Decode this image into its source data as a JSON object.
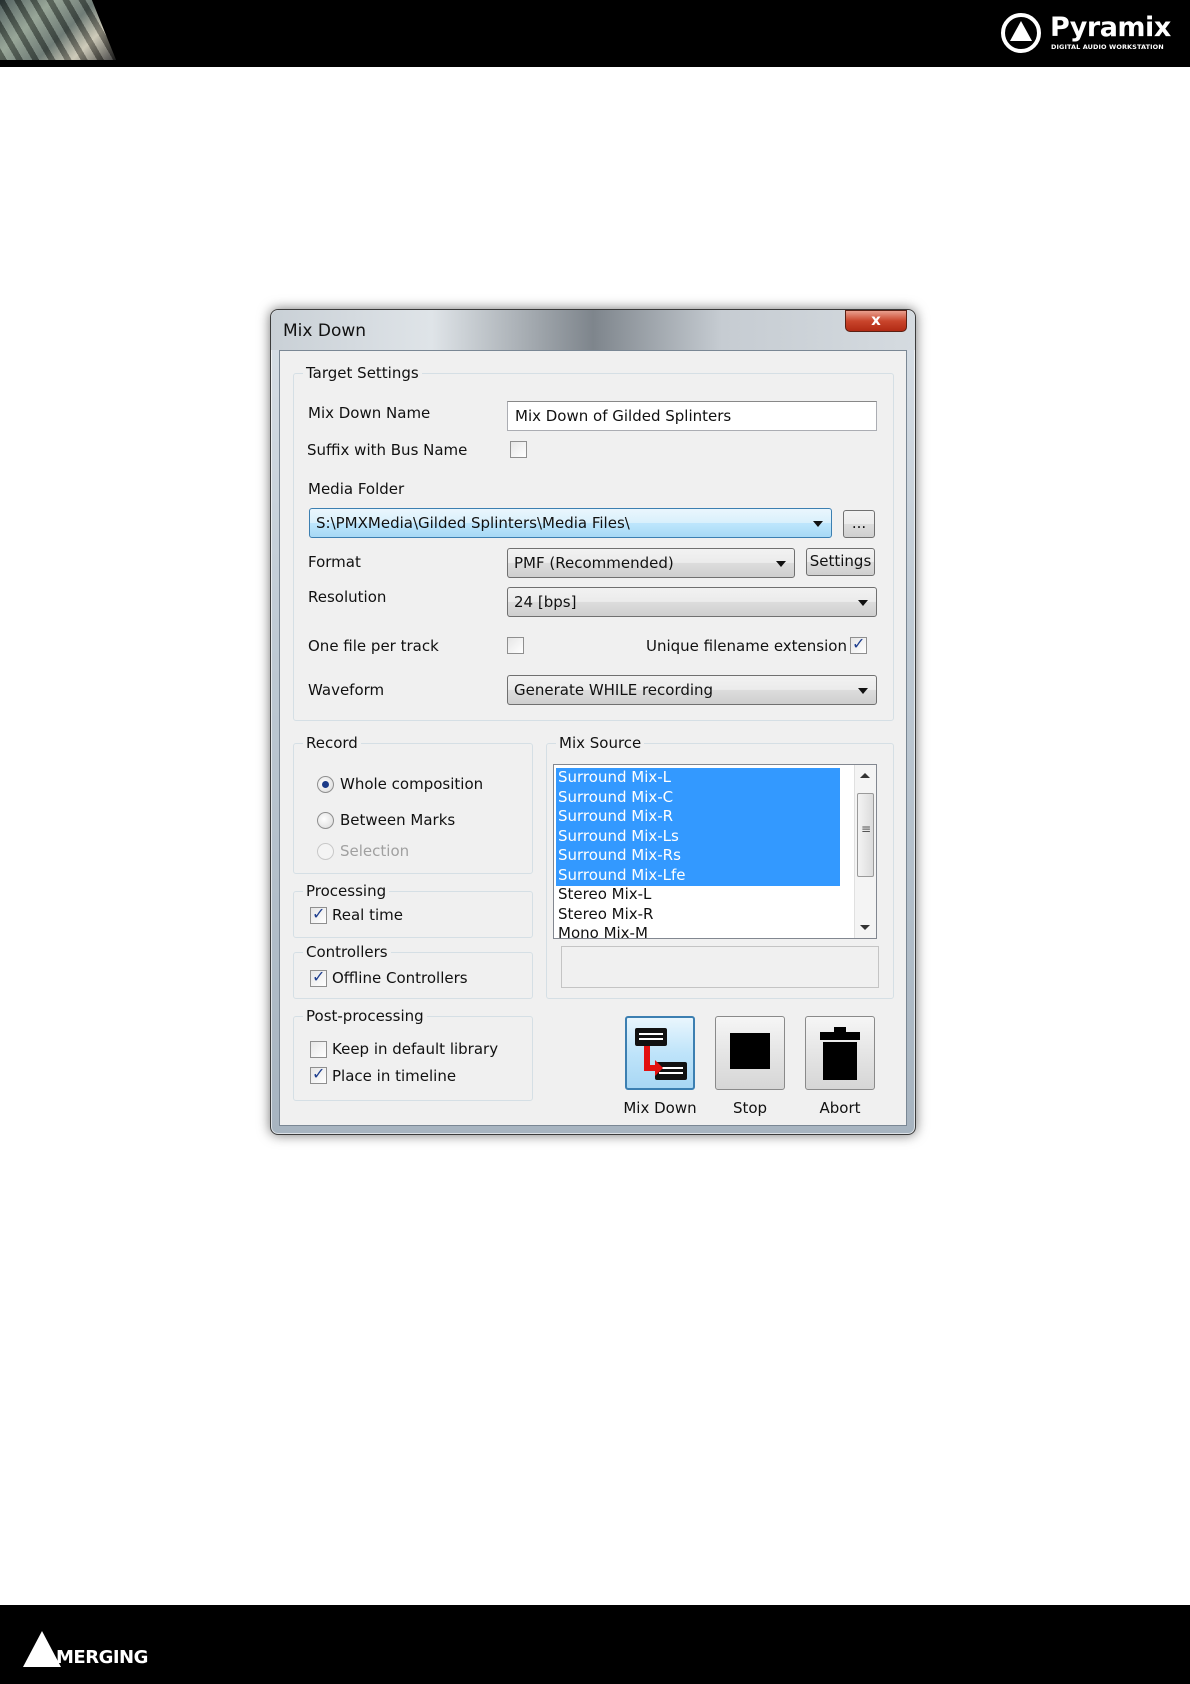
{
  "header": {
    "brand_title": "Pyramix",
    "brand_subtitle": "DIGITAL AUDIO WORKSTATION",
    "photo_icon": "mixing-console-photo"
  },
  "footer": {
    "brand": "MERGING"
  },
  "dialog": {
    "title": "Mix Down",
    "close_label": "x"
  },
  "target_settings": {
    "group_title": "Target Settings",
    "mix_down_name_label": "Mix Down Name",
    "mix_down_name_value": "Mix Down of Gilded Splinters",
    "suffix_label": "Suffix with Bus Name",
    "suffix_checked": false,
    "media_folder_label": "Media Folder",
    "media_folder_value": "S:\\PMXMedia\\Gilded Splinters\\Media Files\\",
    "browse_label": "...",
    "format_label": "Format",
    "format_value": "PMF (Recommended)",
    "settings_label": "Settings",
    "resolution_label": "Resolution",
    "resolution_value": "24 [bps]",
    "one_file_label": "One file per track",
    "one_file_checked": false,
    "unique_ext_label": "Unique filename extension",
    "unique_ext_checked": true,
    "waveform_label": "Waveform",
    "waveform_value": "Generate WHILE recording"
  },
  "record": {
    "group_title": "Record",
    "options": [
      "Whole composition",
      "Between Marks",
      "Selection"
    ],
    "selected": "Whole composition"
  },
  "processing": {
    "group_title": "Processing",
    "real_time_label": "Real time",
    "real_time_checked": true
  },
  "controllers": {
    "group_title": "Controllers",
    "offline_label": "Offline Controllers",
    "offline_checked": true
  },
  "post_processing": {
    "group_title": "Post-processing",
    "keep_label": "Keep in default library",
    "keep_checked": false,
    "place_label": "Place in timeline",
    "place_checked": true
  },
  "mix_source": {
    "group_title": "Mix Source",
    "items": [
      "Surround Mix-L",
      "Surround Mix-C",
      "Surround Mix-R",
      "Surround Mix-Ls",
      "Surround Mix-Rs",
      "Surround Mix-Lfe",
      "Stereo Mix-L",
      "Stereo Mix-R",
      "Mono Mix-M"
    ],
    "selected_count": 6
  },
  "actions": {
    "mix_down_label": "Mix Down",
    "stop_label": "Stop",
    "abort_label": "Abort"
  },
  "colors": {
    "selection": "#3399ff",
    "header_bg": "#000000",
    "dialog_face": "#f0f0f0"
  }
}
